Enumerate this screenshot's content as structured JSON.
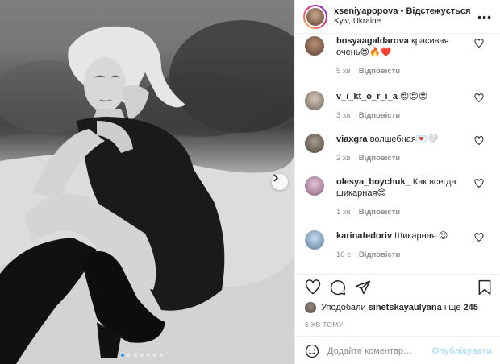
{
  "post": {
    "username": "xseniyapopova",
    "separator": "•",
    "follow_label": "Відстежується",
    "location": "Kyiv, Ukraine",
    "more_label": "•••"
  },
  "comments": [
    {
      "username": "bosyaagaldarova",
      "text": "красивая очень😍🔥❤️",
      "time": "5 хв",
      "reply": "Відповісти"
    },
    {
      "username": "v_i_kt_o_r_i_a",
      "text": "😍😍😍",
      "time": "3 хв",
      "reply": "Відповісти"
    },
    {
      "username": "viaxgra",
      "text": "волшебная💌🤍",
      "time": "2 хв",
      "reply": "Відповісти"
    },
    {
      "username": "olesya_boychuk_",
      "text": "Как всегда шикарная😍",
      "time": "1 хв",
      "reply": "Відповісти"
    },
    {
      "username": "karinafedoriv",
      "text": "Шикарная 😍",
      "time": "10 с",
      "reply": "Відповісти"
    }
  ],
  "likes": {
    "prefix": "Уподобали",
    "user": "sinetskayaulyana",
    "middle": "і ще",
    "count": "245"
  },
  "timestamp": "6 ХВ ТОМУ",
  "comment_box": {
    "placeholder": "Додайте коментар…",
    "publish_label": "Опублікувати"
  },
  "carousel": {
    "slide_count": 7,
    "active_index": 0
  },
  "colors": {
    "accent": "#3897f0",
    "publish_disabled": "#b2dffc",
    "meta_gray": "#8e8e8e",
    "text": "#262626"
  },
  "icons": [
    "heart-icon",
    "comment-icon",
    "share-icon",
    "bookmark-icon",
    "emoji-icon",
    "chevron-right-icon",
    "more-icon"
  ]
}
